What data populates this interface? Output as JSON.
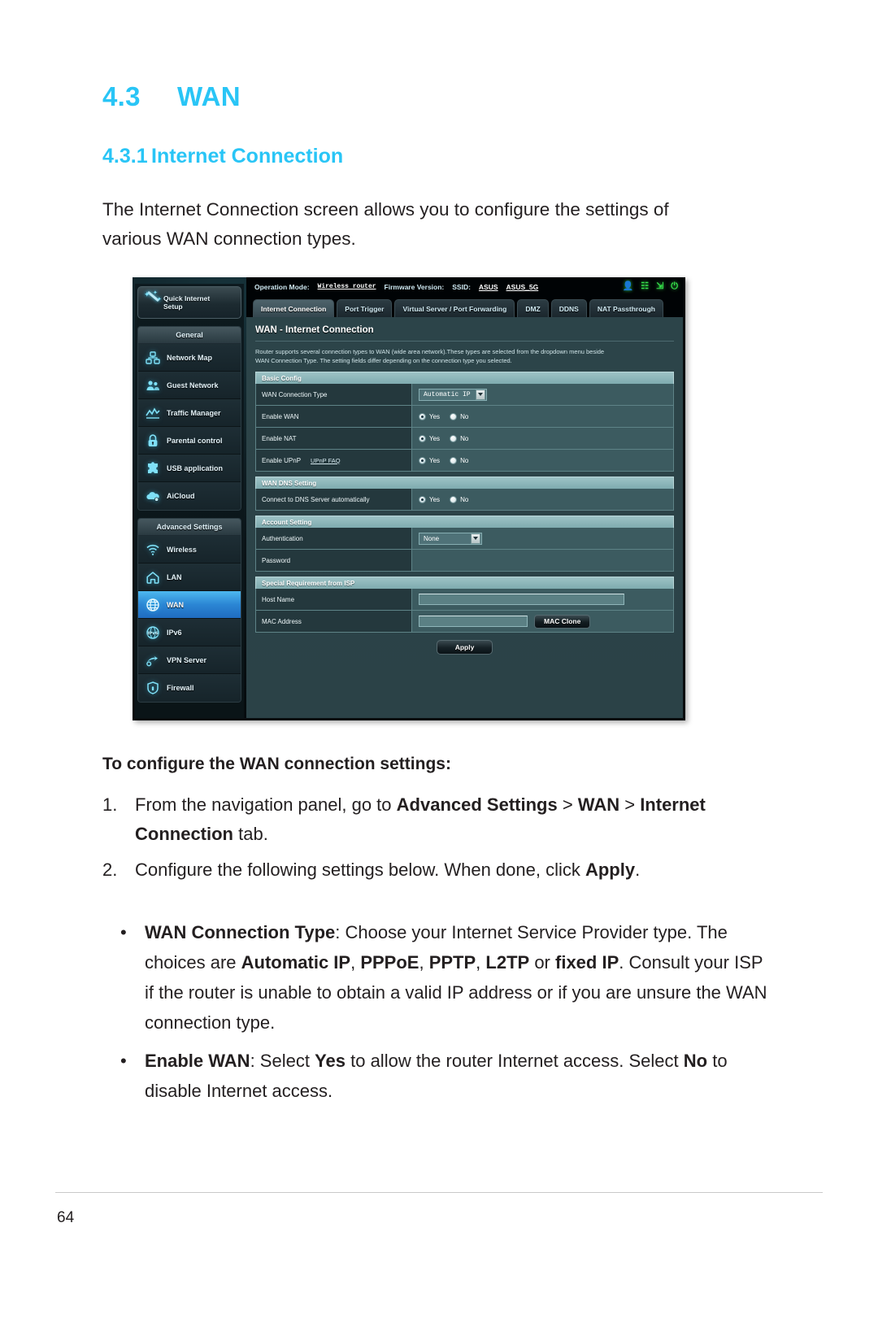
{
  "headings": {
    "section_number": "4.3",
    "section_title": "WAN",
    "sub_number": "4.3.1",
    "sub_title": "Internet Connection"
  },
  "intro": "The Internet Connection screen allows you to configure the settings of various WAN connection types.",
  "router_ui": {
    "quick_setup": {
      "line1": "Quick Internet",
      "line2": "Setup",
      "icon": "magic-wand-icon"
    },
    "nav_groups": [
      {
        "header": "General",
        "items": [
          {
            "label": "Network Map",
            "icon": "network-map-icon",
            "active": false
          },
          {
            "label": "Guest Network",
            "icon": "guest-network-icon",
            "active": false
          },
          {
            "label": "Traffic Manager",
            "icon": "traffic-manager-icon",
            "active": false
          },
          {
            "label": "Parental control",
            "icon": "lock-icon",
            "active": false
          },
          {
            "label": "USB application",
            "icon": "puzzle-icon",
            "active": false
          },
          {
            "label": "AiCloud",
            "icon": "cloud-icon",
            "active": false
          }
        ]
      },
      {
        "header": "Advanced Settings",
        "items": [
          {
            "label": "Wireless",
            "icon": "wifi-icon",
            "active": false
          },
          {
            "label": "LAN",
            "icon": "home-icon",
            "active": false
          },
          {
            "label": "WAN",
            "icon": "globe-icon",
            "active": true
          },
          {
            "label": "IPv6",
            "icon": "ipv6-globe-icon",
            "active": false
          },
          {
            "label": "VPN Server",
            "icon": "vpn-icon",
            "active": false
          },
          {
            "label": "Firewall",
            "icon": "shield-icon",
            "active": false
          }
        ]
      }
    ],
    "topbar": {
      "operation_mode_label": "Operation Mode:",
      "operation_mode_value": "Wireless router",
      "firmware_label": "Firmware Version:",
      "firmware_value": "",
      "ssid_label": "SSID:",
      "ssid_1": "ASUS",
      "ssid_2": "ASUS_5G",
      "icons": [
        "user-icon",
        "copy-icon",
        "usb-icon",
        "reboot-icon"
      ]
    },
    "tabs": [
      {
        "label": "Internet Connection",
        "active": true
      },
      {
        "label": "Port Trigger",
        "active": false
      },
      {
        "label": "Virtual Server / Port Forwarding",
        "active": false
      },
      {
        "label": "DMZ",
        "active": false
      },
      {
        "label": "DDNS",
        "active": false
      },
      {
        "label": "NAT Passthrough",
        "active": false
      }
    ],
    "content_title": "WAN - Internet Connection",
    "content_desc_line1": "Router supports several connection types to WAN (wide area network).These types are selected from the dropdown menu beside",
    "content_desc_line2": "WAN Connection Type. The setting fields differ depending on the connection type you selected.",
    "sections": [
      {
        "header": "Basic Config",
        "rows": [
          {
            "label": "WAN Connection Type",
            "link": "",
            "control": "select",
            "value": "Automatic IP"
          },
          {
            "label": "Enable WAN",
            "link": "",
            "control": "radio",
            "yes": "Yes",
            "no": "No",
            "selected": "Yes"
          },
          {
            "label": "Enable NAT",
            "link": "",
            "control": "radio",
            "yes": "Yes",
            "no": "No",
            "selected": "Yes"
          },
          {
            "label": "Enable UPnP",
            "link": "UPnP FAQ",
            "control": "radio",
            "yes": "Yes",
            "no": "No",
            "selected": "Yes"
          }
        ]
      },
      {
        "header": "WAN DNS Setting",
        "rows": [
          {
            "label": "Connect to DNS Server automatically",
            "link": "",
            "control": "radio",
            "yes": "Yes",
            "no": "No",
            "selected": "Yes"
          }
        ]
      },
      {
        "header": "Account Setting",
        "rows": [
          {
            "label": "Authentication",
            "link": "",
            "control": "select-plain",
            "value": "None"
          },
          {
            "label": "Password",
            "link": "",
            "control": "empty",
            "value": ""
          }
        ]
      },
      {
        "header": "Special Requirement from ISP",
        "rows": [
          {
            "label": "Host Name",
            "link": "",
            "control": "text-host",
            "value": ""
          },
          {
            "label": "MAC Address",
            "link": "",
            "control": "text-mac-button",
            "value": "",
            "button": "MAC Clone"
          }
        ]
      }
    ],
    "apply_button": "Apply"
  },
  "procedure": {
    "subhead": "To configure the WAN connection settings:",
    "steps": [
      {
        "mark": "1.",
        "parts": [
          {
            "text": "From the navigation panel, go to ",
            "bold": false
          },
          {
            "text": "Advanced Settings",
            "bold": true
          },
          {
            "text": " > ",
            "bold": false
          },
          {
            "text": "WAN",
            "bold": true
          },
          {
            "text": " > ",
            "bold": false
          },
          {
            "text": "Internet Connection",
            "bold": true
          },
          {
            "text": " tab.",
            "bold": false
          }
        ]
      },
      {
        "mark": "2.",
        "parts": [
          {
            "text": "Configure the following settings below. When done, click ",
            "bold": false
          },
          {
            "text": "Apply",
            "bold": true
          },
          {
            "text": ".",
            "bold": false
          }
        ]
      }
    ]
  },
  "bullets": [
    {
      "mark": "•",
      "parts": [
        {
          "text": "WAN Connection Type",
          "bold": true
        },
        {
          "text": ": Choose your Internet Service Provider type. The choices are ",
          "bold": false
        },
        {
          "text": "Automatic IP",
          "bold": true
        },
        {
          "text": ", ",
          "bold": false
        },
        {
          "text": "PPPoE",
          "bold": true
        },
        {
          "text": ", ",
          "bold": false
        },
        {
          "text": "PPTP",
          "bold": true
        },
        {
          "text": ", ",
          "bold": false
        },
        {
          "text": "L2TP",
          "bold": true
        },
        {
          "text": " or ",
          "bold": false
        },
        {
          "text": "fixed IP",
          "bold": true
        },
        {
          "text": ". Consult your ISP if the router is unable to obtain a valid IP address or if you are unsure the WAN connection type.",
          "bold": false
        }
      ]
    },
    {
      "mark": "•",
      "parts": [
        {
          "text": "Enable WAN",
          "bold": true
        },
        {
          "text": ": Select ",
          "bold": false
        },
        {
          "text": "Yes",
          "bold": true
        },
        {
          "text": " to allow the router Internet access. Select ",
          "bold": false
        },
        {
          "text": "No",
          "bold": true
        },
        {
          "text": " to disable Internet access.",
          "bold": false
        }
      ]
    }
  ],
  "page_number": "64",
  "colors": {
    "heading_blue": "#29c5f6",
    "body_black": "#231f20",
    "ui_panel": "#2c4449",
    "ui_active_nav": "#2b86d4"
  }
}
